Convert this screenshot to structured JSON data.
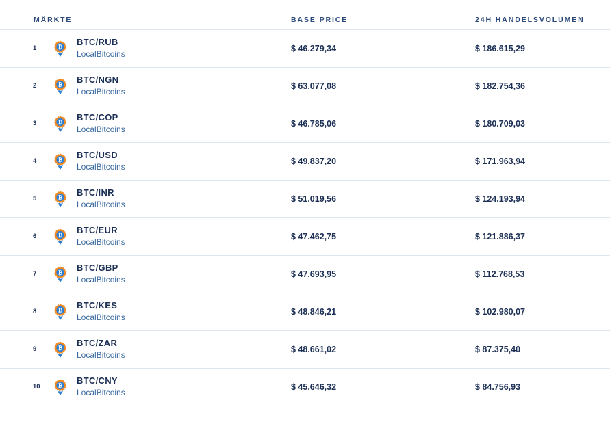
{
  "colors": {
    "header_text": "#2b4a7a",
    "primary_text": "#1c2f55",
    "secondary_text": "#3a6aa0",
    "divider": "#dde6f0",
    "logo_orange": "#f08a24",
    "logo_blue": "#2d7fd3"
  },
  "header": {
    "markets": "MÄRKTE",
    "base_price": "BASE PRICE",
    "volume": "24H HANDELSVOLUMEN"
  },
  "rows": [
    {
      "rank": "1",
      "pair": "BTC/RUB",
      "exchange": "LocalBitcoins",
      "price": "$ 46.279,34",
      "volume": "$ 186.615,29",
      "icon": "localbitcoins-logo-icon"
    },
    {
      "rank": "2",
      "pair": "BTC/NGN",
      "exchange": "LocalBitcoins",
      "price": "$ 63.077,08",
      "volume": "$ 182.754,36",
      "icon": "localbitcoins-logo-icon"
    },
    {
      "rank": "3",
      "pair": "BTC/COP",
      "exchange": "LocalBitcoins",
      "price": "$ 46.785,06",
      "volume": "$ 180.709,03",
      "icon": "localbitcoins-logo-icon"
    },
    {
      "rank": "4",
      "pair": "BTC/USD",
      "exchange": "LocalBitcoins",
      "price": "$ 49.837,20",
      "volume": "$ 171.963,94",
      "icon": "localbitcoins-logo-icon"
    },
    {
      "rank": "5",
      "pair": "BTC/INR",
      "exchange": "LocalBitcoins",
      "price": "$ 51.019,56",
      "volume": "$ 124.193,94",
      "icon": "localbitcoins-logo-icon"
    },
    {
      "rank": "6",
      "pair": "BTC/EUR",
      "exchange": "LocalBitcoins",
      "price": "$ 47.462,75",
      "volume": "$ 121.886,37",
      "icon": "localbitcoins-logo-icon"
    },
    {
      "rank": "7",
      "pair": "BTC/GBP",
      "exchange": "LocalBitcoins",
      "price": "$ 47.693,95",
      "volume": "$ 112.768,53",
      "icon": "localbitcoins-logo-icon"
    },
    {
      "rank": "8",
      "pair": "BTC/KES",
      "exchange": "LocalBitcoins",
      "price": "$ 48.846,21",
      "volume": "$ 102.980,07",
      "icon": "localbitcoins-logo-icon"
    },
    {
      "rank": "9",
      "pair": "BTC/ZAR",
      "exchange": "LocalBitcoins",
      "price": "$ 48.661,02",
      "volume": "$ 87.375,40",
      "icon": "localbitcoins-logo-icon"
    },
    {
      "rank": "10",
      "pair": "BTC/CNY",
      "exchange": "LocalBitcoins",
      "price": "$ 45.646,32",
      "volume": "$ 84.756,93",
      "icon": "localbitcoins-logo-icon"
    }
  ]
}
